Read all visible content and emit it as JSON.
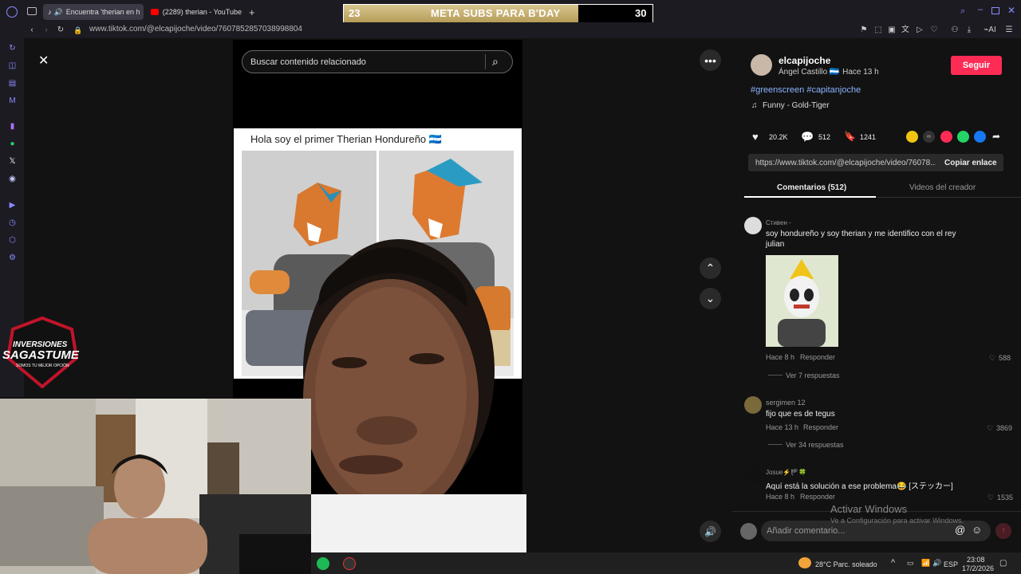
{
  "browser": {
    "tabs": [
      {
        "label": "Encuentra 'therian en h",
        "icon": "tiktok-icon"
      },
      {
        "label": "(2289) therian - YouTube",
        "icon": "youtube-icon"
      }
    ],
    "url": "www.tiktok.com/@elcapijoche/video/7607852857038998804"
  },
  "stream_overlay": {
    "subs_current": "23",
    "subs_title": "META SUBS PARA B'DAY",
    "subs_goal": "30",
    "logo_line1": "INVERSIONES",
    "logo_line2": "SAGASTUME",
    "logo_tagline": "SOMOS TU MEJOR OPCIÓN"
  },
  "video": {
    "search_placeholder": "Buscar contenido relacionado",
    "post_text": "Hola soy el primer Therian Hondureño 🇭🇳"
  },
  "creator": {
    "username": "elcapijoche",
    "display_name": "Ángel Castillo 🇭🇳",
    "time_ago": "· Hace 13 h",
    "follow_label": "Seguir",
    "hashtags": "#greenscreen #capitanjoche",
    "music": "Funny - Gold-Tiger"
  },
  "stats": {
    "likes": "20.2K",
    "comments": "512",
    "saves": "1241"
  },
  "link": {
    "url": "https://www.tiktok.com/@elcapijoche/video/76078...",
    "copy_label": "Copiar enlace"
  },
  "panel_tabs": {
    "comments": "Comentarios (512)",
    "creator_videos": "Videos del creador"
  },
  "comments": [
    {
      "user": "Стивен -",
      "text": "soy hondureño y soy therian y me identifico con el rey julian",
      "time": "Hace 8 h",
      "reply": "Responder",
      "likes": "588",
      "replies": "Ver 7 respuestas"
    },
    {
      "user": "sergimen 12",
      "text": "fijo que es de tegus",
      "time": "Hace 13 h",
      "reply": "Responder",
      "likes": "3869",
      "replies": "Ver 34 respuestas"
    },
    {
      "user": "Josue⚡🏴🍀",
      "text": "Aquí está la solución a ese problema😂 [ステッカー]",
      "time": "Hace 8 h",
      "reply": "Responder",
      "likes": "1535"
    }
  ],
  "comment_input": {
    "placeholder": "Añadir comentario..."
  },
  "windows_watermark": {
    "line1": "Activar Windows",
    "line2": "Ve a Configuración para activar Windows."
  },
  "taskbar": {
    "weather": "28°C  Parc. soleado",
    "lang": "ESP",
    "time": "23:08",
    "date": "17/2/2026"
  }
}
